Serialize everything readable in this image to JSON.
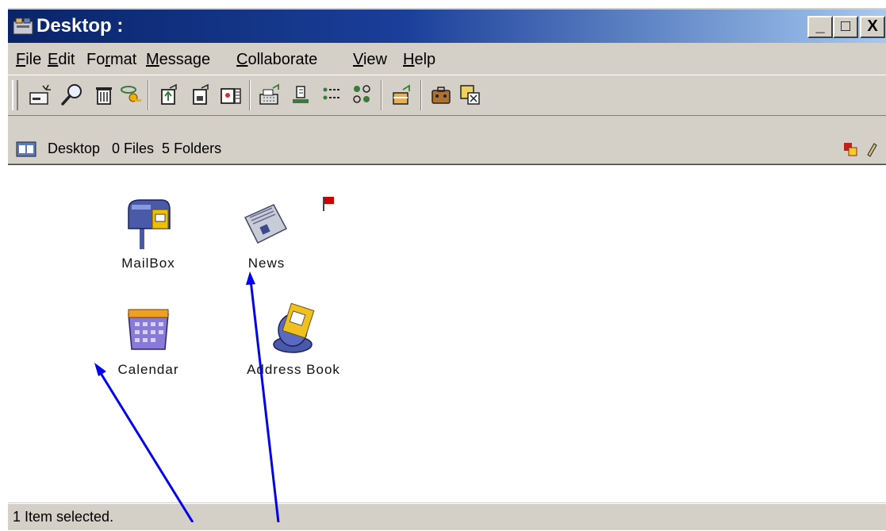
{
  "window": {
    "title": "Desktop :",
    "controls": {
      "minimize": "_",
      "maximize": "□",
      "close": "X"
    }
  },
  "menu": {
    "items": [
      {
        "pre": "",
        "accel": "F",
        "post": "ile"
      },
      {
        "pre": "",
        "accel": "E",
        "post": "dit"
      },
      {
        "pre": "Fo",
        "accel": "r",
        "post": "mat"
      },
      {
        "pre": "",
        "accel": "M",
        "post": "essage"
      },
      {
        "pre": "",
        "accel": "C",
        "post": "ollaborate"
      },
      {
        "pre": "",
        "accel": "V",
        "post": "iew"
      },
      {
        "pre": "",
        "accel": "H",
        "post": "elp"
      }
    ]
  },
  "toolbar": {
    "icons": [
      "new-message-icon",
      "find-icon",
      "delete-icon",
      "keys-icon",
      "folder-up-icon",
      "folder-out-icon",
      "folder-edit-icon",
      "fax-icon",
      "printer-icon",
      "list-icon",
      "users-icon",
      "outbox-icon",
      "briefcase-icon",
      "window-icon"
    ]
  },
  "pathbar": {
    "text": "Desktop   0 Files  5 Folders"
  },
  "desktop": {
    "items": [
      {
        "label": "MailBox",
        "icon": "mailbox-icon"
      },
      {
        "label": "News",
        "icon": "newspaper-icon"
      },
      {
        "label": "Calendar",
        "icon": "calendar-icon"
      },
      {
        "label": "Address Book",
        "icon": "address-book-icon"
      }
    ]
  },
  "status": {
    "text": "1 Item selected."
  },
  "colors": {
    "titlebar_start": "#0a246a",
    "titlebar_end": "#a6caf0",
    "chrome": "#d4d0c8",
    "annotation_arrow": "#0000ee",
    "flag": "#cc0000"
  }
}
